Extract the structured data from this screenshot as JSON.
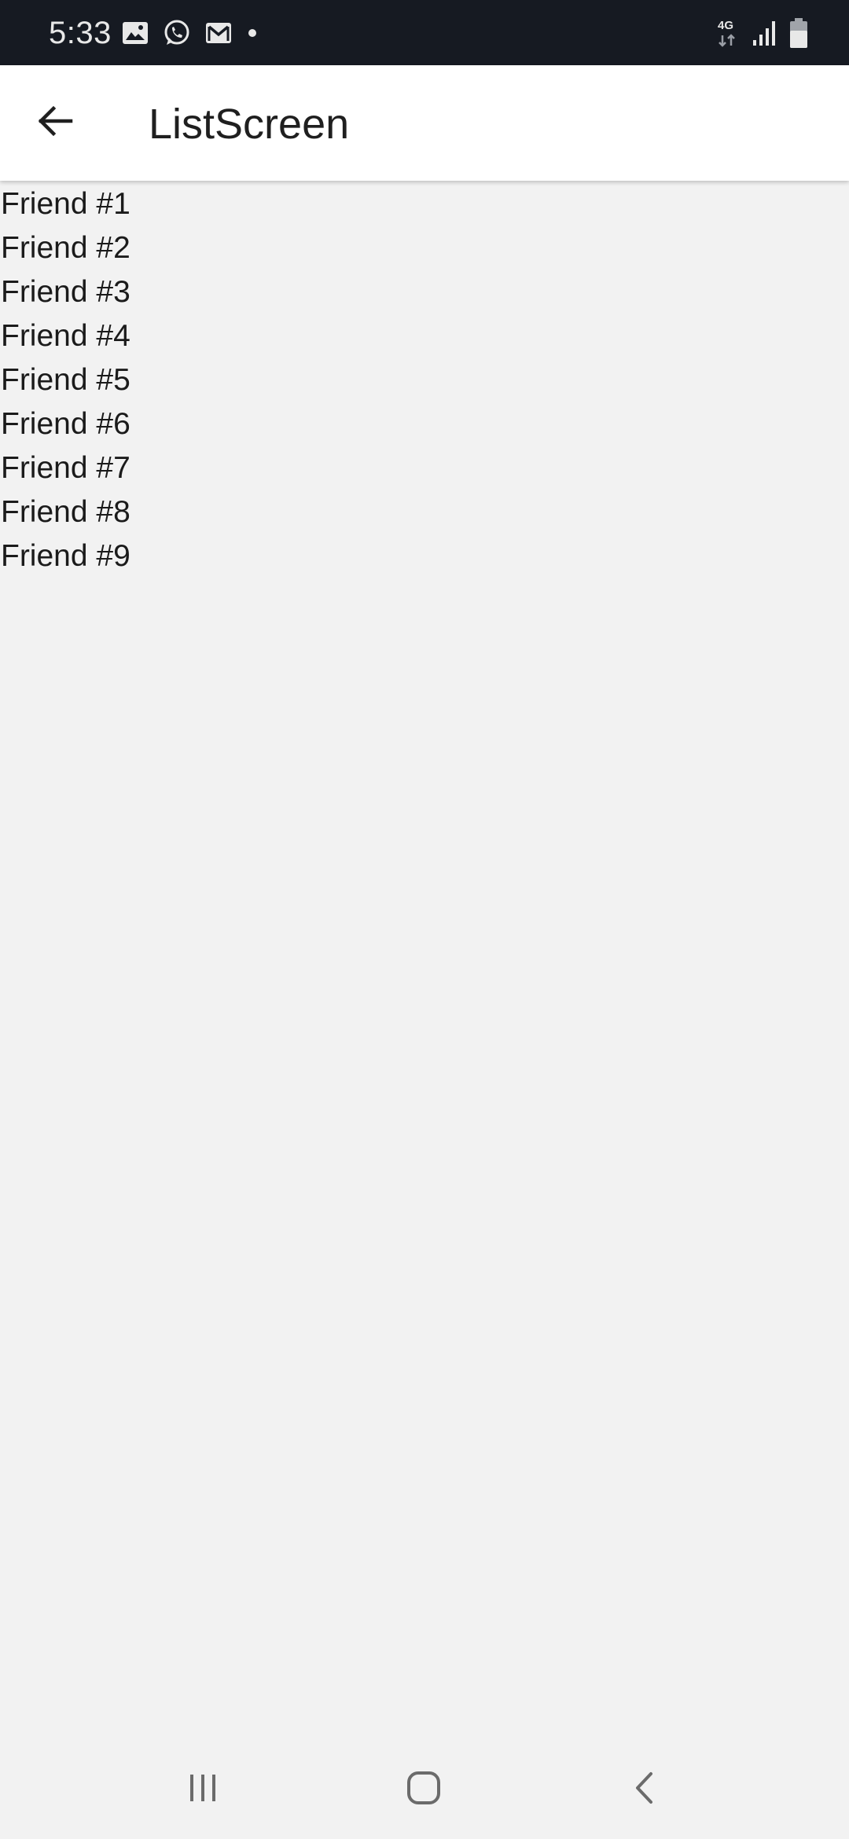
{
  "status_bar": {
    "time": "5:33",
    "left_icons": [
      "gallery-icon",
      "whatsapp-icon",
      "gmail-icon",
      "notification-dot-icon"
    ],
    "network_label": "4G",
    "right_icons": [
      "network-4g-icon",
      "signal-icon",
      "battery-icon"
    ]
  },
  "app_bar": {
    "title": "ListScreen",
    "back_icon": "arrow-back-icon"
  },
  "friends": [
    "Friend #1",
    "Friend #2",
    "Friend #3",
    "Friend #4",
    "Friend #5",
    "Friend #6",
    "Friend #7",
    "Friend #8",
    "Friend #9"
  ],
  "nav_bar": {
    "buttons": [
      "recents-icon",
      "home-icon",
      "back-icon"
    ]
  },
  "colors": {
    "status_bar_bg": "#161a22",
    "app_bar_bg": "#ffffff",
    "content_bg": "#f2f2f2",
    "text": "#1b1b1b"
  }
}
